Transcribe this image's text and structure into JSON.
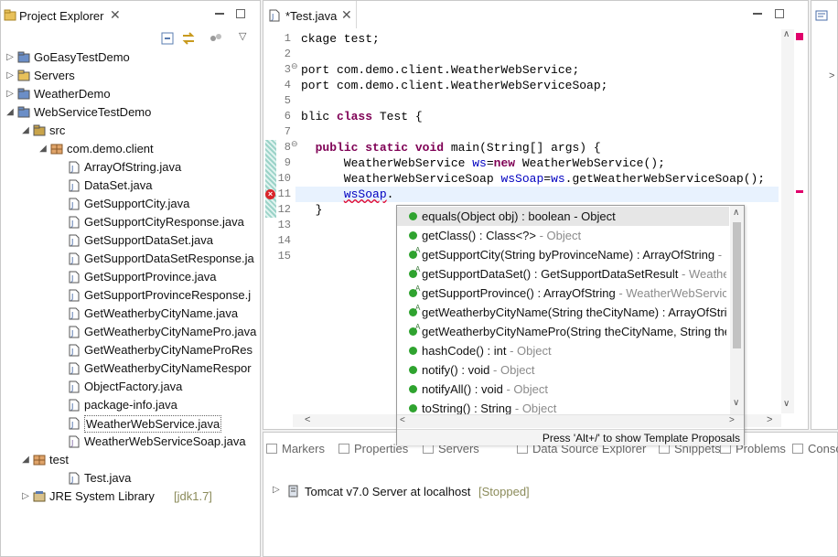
{
  "explorer": {
    "title": "Project Explorer",
    "items": [
      {
        "label": "GoEasyTestDemo",
        "type": "project",
        "depth": 0,
        "expanded": false
      },
      {
        "label": "Servers",
        "type": "folder",
        "depth": 0,
        "expanded": false
      },
      {
        "label": "WeatherDemo",
        "type": "project",
        "depth": 0,
        "expanded": false
      },
      {
        "label": "WebServiceTestDemo",
        "type": "project",
        "depth": 0,
        "expanded": true
      },
      {
        "label": "src",
        "type": "srcfolder",
        "depth": 1,
        "expanded": true
      },
      {
        "label": "com.demo.client",
        "type": "package",
        "depth": 2,
        "expanded": true
      },
      {
        "label": "ArrayOfString.java",
        "type": "java",
        "depth": 3
      },
      {
        "label": "DataSet.java",
        "type": "java",
        "depth": 3
      },
      {
        "label": "GetSupportCity.java",
        "type": "java",
        "depth": 3
      },
      {
        "label": "GetSupportCityResponse.java",
        "type": "java",
        "depth": 3
      },
      {
        "label": "GetSupportDataSet.java",
        "type": "java",
        "depth": 3
      },
      {
        "label": "GetSupportDataSetResponse.ja",
        "type": "java",
        "depth": 3
      },
      {
        "label": "GetSupportProvince.java",
        "type": "java",
        "depth": 3
      },
      {
        "label": "GetSupportProvinceResponse.j",
        "type": "java",
        "depth": 3
      },
      {
        "label": "GetWeatherbyCityName.java",
        "type": "java",
        "depth": 3
      },
      {
        "label": "GetWeatherbyCityNamePro.java",
        "type": "java",
        "depth": 3
      },
      {
        "label": "GetWeatherbyCityNameProRes",
        "type": "java",
        "depth": 3
      },
      {
        "label": "GetWeatherbyCityNameRespor",
        "type": "java",
        "depth": 3
      },
      {
        "label": "ObjectFactory.java",
        "type": "java",
        "depth": 3
      },
      {
        "label": "package-info.java",
        "type": "java",
        "depth": 3
      },
      {
        "label": "WeatherWebService.java",
        "type": "java",
        "depth": 3,
        "selected": true
      },
      {
        "label": "WeatherWebServiceSoap.java",
        "type": "java-interface",
        "depth": 3
      },
      {
        "label": "test",
        "type": "package",
        "depth": 1,
        "expanded": true
      },
      {
        "label": "Test.java",
        "type": "java",
        "depth": 3
      },
      {
        "label": "JRE System Library",
        "type": "library",
        "depth": 1,
        "expanded": false,
        "suffix": "[jdk1.7]"
      }
    ]
  },
  "editor": {
    "tab_title": "*Test.java",
    "lines": [
      {
        "n": "1",
        "code": "ckage test;"
      },
      {
        "n": "2",
        "code": ""
      },
      {
        "n": "3",
        "code": "port com.demo.client.WeatherWebService;",
        "fold": true
      },
      {
        "n": "4",
        "code": "port com.demo.client.WeatherWebServiceSoap;"
      },
      {
        "n": "5",
        "code": ""
      },
      {
        "n": "6",
        "code": "blic class Test {"
      },
      {
        "n": "7",
        "code": ""
      },
      {
        "n": "8",
        "code": "  public static void main(String[] args) {",
        "fold": true
      },
      {
        "n": "9",
        "code": "      WeatherWebService ws=new WeatherWebService();"
      },
      {
        "n": "10",
        "code": "      WeatherWebServiceSoap wsSoap=ws.getWeatherWebServiceSoap();"
      },
      {
        "n": "11",
        "code": "      wsSoap.",
        "error": true
      },
      {
        "n": "12",
        "code": "  }"
      },
      {
        "n": "13",
        "code": ""
      },
      {
        "n": "14",
        "code": ""
      },
      {
        "n": "15",
        "code": ""
      }
    ]
  },
  "popup": {
    "items": [
      {
        "main": "equals(Object obj) : boolean - Object",
        "gray": "",
        "selected": true
      },
      {
        "main": "getClass() : Class<?>",
        "gray": " - Object"
      },
      {
        "main": "getSupportCity(String byProvinceName) : ArrayOfString",
        "gray": " - ",
        "abstract": true
      },
      {
        "main": "getSupportDataSet() : GetSupportDataSetResult",
        "gray": " - Weathe",
        "abstract": true
      },
      {
        "main": "getSupportProvince() : ArrayOfString",
        "gray": " - WeatherWebServic",
        "abstract": true
      },
      {
        "main": "getWeatherbyCityName(String theCityName) : ArrayOfStri",
        "gray": "",
        "abstract": true
      },
      {
        "main": "getWeatherbyCityNamePro(String theCityName, String the",
        "gray": "",
        "abstract": true
      },
      {
        "main": "hashCode() : int",
        "gray": " - Object"
      },
      {
        "main": "notify() : void",
        "gray": " - Object"
      },
      {
        "main": "notifyAll() : void",
        "gray": " - Object"
      },
      {
        "main": "toString() : String",
        "gray": " - Object"
      }
    ],
    "footer": "Press 'Alt+/' to show Template Proposals"
  },
  "bottom": {
    "tabs": [
      "Markers",
      "Properties",
      "Servers",
      "Data Source Explorer",
      "Snippets",
      "Problems",
      "Console"
    ],
    "server": {
      "name": "Tomcat v7.0 Server at localhost",
      "status": "[Stopped]"
    }
  }
}
